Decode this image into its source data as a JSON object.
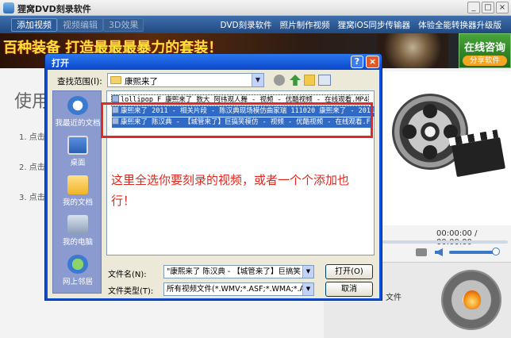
{
  "app": {
    "title": "狸窝DVD刻录软件",
    "window_buttons": [
      "_",
      "□",
      "×"
    ]
  },
  "menubar": {
    "tabs": [
      "添加视频",
      "视频编辑",
      "3D效果"
    ],
    "links": [
      "DVD刻录软件",
      "照片制作视频",
      "狸窝iOS同步传输器",
      "体验全能转换器升级版"
    ]
  },
  "banner": {
    "slogan": "百种装备 打造最最最暴力的套装！",
    "consult_title": "在线咨询",
    "consult_sub": "分享软件"
  },
  "main": {
    "usage_title": "使用",
    "steps": [
      "1. 点击",
      "2. 点击",
      "3. 点击"
    ],
    "time": "00:00:00 / 00:00:00",
    "volume_fraction": 0.95,
    "fit_label": "文件"
  },
  "dialog": {
    "title": "打开",
    "help": "?",
    "close": "×",
    "look_in_label": "查找范围(I):",
    "look_in_value": "康熙来了",
    "places": [
      "我最近的文档",
      "桌面",
      "我的文档",
      "我的电脑",
      "网上邻居"
    ],
    "files": [
      "lollipop F 康熙来了 数大 阿纬观人舞 - 视频 - 优酷视频 - 在线观看.MP4",
      "康熙来了 2011 - 相关片段 - 陈汉典现场模仿曲家瑞 111020 康熙来了 - 2011",
      "康熙来了 陈汉典 - 【城管来了】巨搞笑模仿 - 视频 - 优酷视频 - 在线观看.F"
    ],
    "annotation": "这里全选你要刻录的视频，或者一个个添加也行！",
    "filename_label": "文件名(N):",
    "filename_value": "\"康熙来了 陈汉典 - 【城管来了】巨搞笑",
    "filetype_label": "文件类型(T):",
    "filetype_value": "所有视频文件(*.WMV;*.ASF;*.WMA;*.AVI;",
    "open_button": "打开(O)",
    "cancel_button": "取消"
  },
  "colors": {
    "annotation_red": "#e0271c",
    "highlight_red": "#e3262c",
    "selection_blue": "#316ac5",
    "xp_title_blue": "#0a47c9"
  }
}
